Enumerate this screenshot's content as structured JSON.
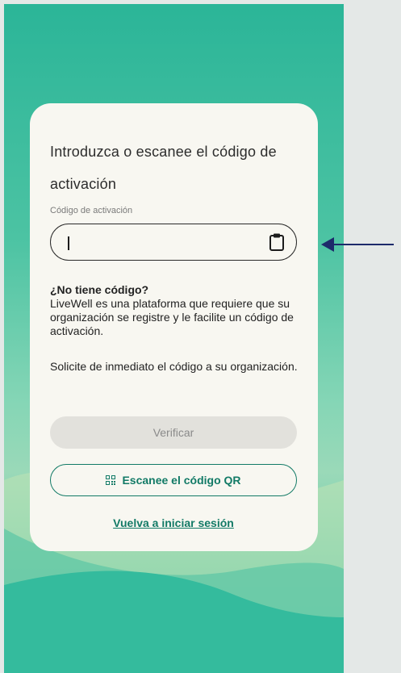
{
  "card": {
    "title": "Introduzca o escanee el código de activación",
    "field_label": "Código de activación",
    "input_value": "",
    "no_code_heading": "¿No tiene código?",
    "no_code_text": "LiveWell es una plataforma que requiere que su organización se registre y le facilite un código de activación.",
    "request_text": "Solicite de inmediato el código a su organización.",
    "verify_label": "Verificar",
    "scan_qr_label": "Escanee el código QR",
    "relogin_label": "Vuelva a iniciar sesión"
  },
  "icons": {
    "paste": "clipboard-icon",
    "qr": "qr-code-icon",
    "annotation": "arrow-left-icon"
  },
  "colors": {
    "accent": "#127a66",
    "background_top": "#2bb598",
    "card": "#f8f7f1",
    "arrow": "#1d2a6b",
    "disabled_button": "#e2e1dc"
  }
}
